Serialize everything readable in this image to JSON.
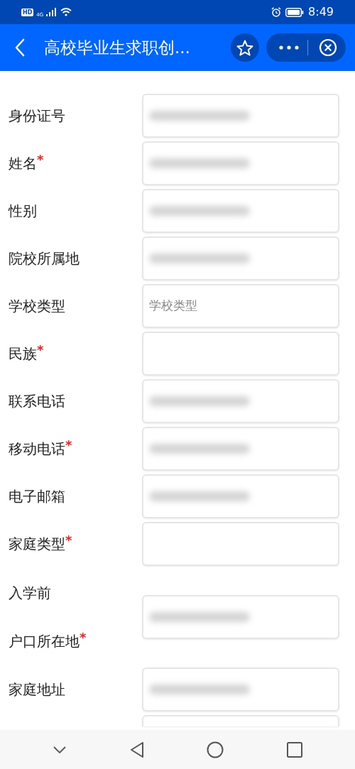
{
  "status_bar": {
    "hd_badge": "HD",
    "network": "4G",
    "time": "8:49"
  },
  "header": {
    "title": "高校毕业生求职创..."
  },
  "fields": [
    {
      "label_lines": [
        "身份证号"
      ],
      "kind": "redacted"
    },
    {
      "label_lines": [
        "姓名"
      ],
      "required_mark": "*",
      "kind": "redacted"
    },
    {
      "label_lines": [
        "性别"
      ],
      "kind": "redacted"
    },
    {
      "label_lines": [
        "院校所属地"
      ],
      "kind": "redacted"
    },
    {
      "label_lines": [
        "学校类型"
      ],
      "kind": "placeholder",
      "placeholder": "学校类型"
    },
    {
      "label_lines": [
        "民族"
      ],
      "required_mark": "*",
      "kind": "empty"
    },
    {
      "label_lines": [
        "联系电话"
      ],
      "kind": "redacted"
    },
    {
      "label_lines": [
        "移动电话"
      ],
      "required_mark": "*",
      "kind": "redacted"
    },
    {
      "label_lines": [
        "电子邮箱"
      ],
      "kind": "redacted"
    },
    {
      "label_lines": [
        "家庭类型"
      ],
      "required_mark": "*",
      "kind": "empty"
    },
    {
      "label_lines": [
        "入学前",
        "户口所在地"
      ],
      "required_mark": "*",
      "kind": "redacted"
    },
    {
      "label_lines": [
        "家庭地址"
      ],
      "kind": "redacted"
    },
    {
      "kind": "cut_off"
    }
  ]
}
